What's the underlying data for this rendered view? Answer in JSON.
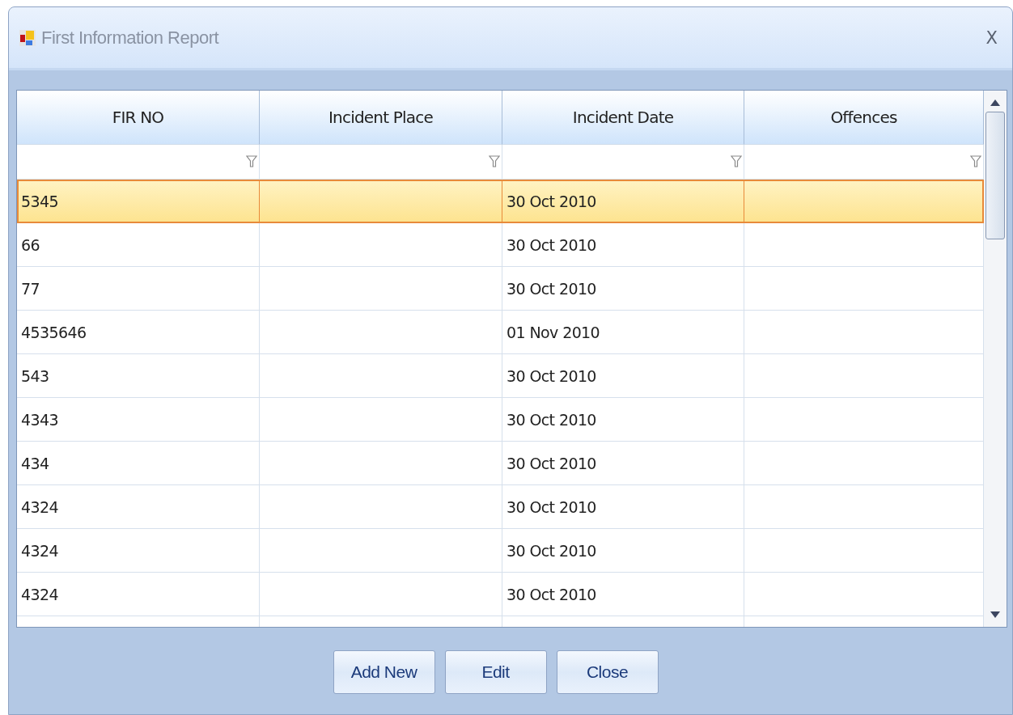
{
  "window": {
    "title": "First Information Report",
    "close": "X"
  },
  "table": {
    "columns": [
      "FIR NO",
      "Incident Place",
      "Incident Date",
      "Offences"
    ],
    "rows": [
      {
        "fir_no": "5345",
        "incident_date": "30 Oct 2010",
        "selected": true
      },
      {
        "fir_no": "66",
        "incident_date": "30 Oct 2010",
        "selected": false
      },
      {
        "fir_no": "77",
        "incident_date": "30 Oct 2010",
        "selected": false
      },
      {
        "fir_no": "4535646",
        "incident_date": "01 Nov 2010",
        "selected": false
      },
      {
        "fir_no": "543",
        "incident_date": "30 Oct 2010",
        "selected": false
      },
      {
        "fir_no": "4343",
        "incident_date": "30 Oct 2010",
        "selected": false
      },
      {
        "fir_no": "434",
        "incident_date": "30 Oct 2010",
        "selected": false
      },
      {
        "fir_no": "4324",
        "incident_date": "30 Oct 2010",
        "selected": false
      },
      {
        "fir_no": "4324",
        "incident_date": "30 Oct 2010",
        "selected": false
      },
      {
        "fir_no": "4324",
        "incident_date": "30 Oct 2010",
        "selected": false
      }
    ]
  },
  "buttons": [
    "Add New",
    "Edit",
    "Close"
  ]
}
